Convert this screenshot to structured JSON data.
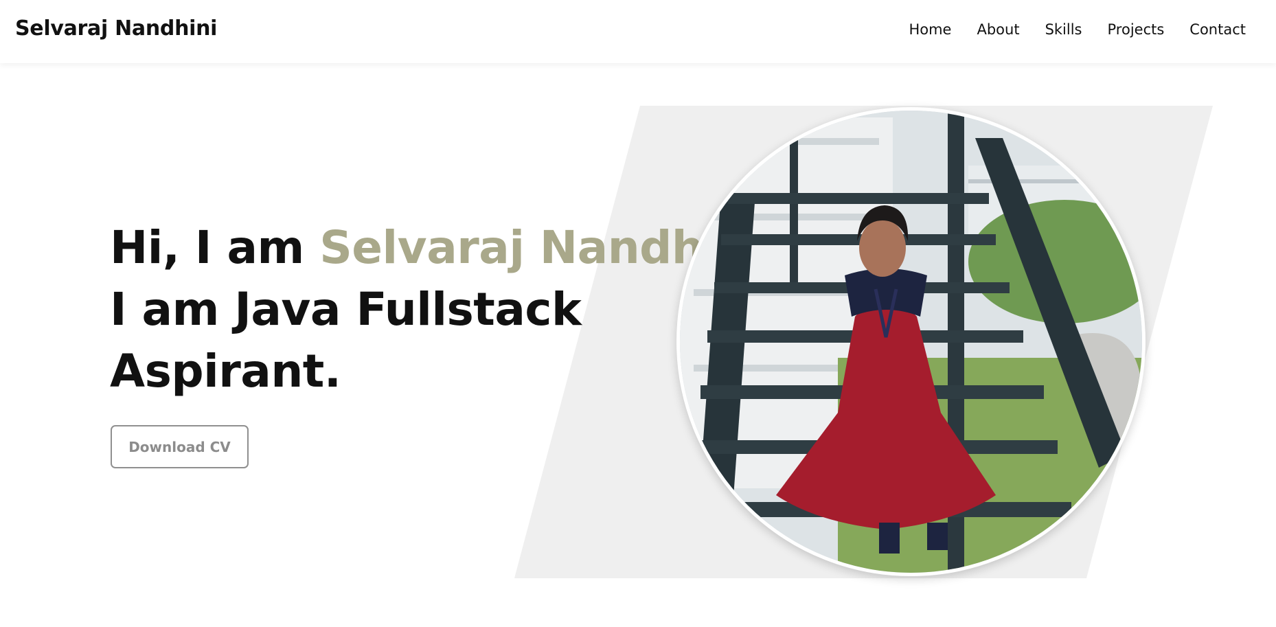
{
  "nav": {
    "brand": "Selvaraj Nandhini",
    "links": [
      {
        "label": "Home"
      },
      {
        "label": "About"
      },
      {
        "label": "Skills"
      },
      {
        "label": "Projects"
      },
      {
        "label": "Contact"
      }
    ]
  },
  "hero": {
    "greeting": "Hi, I am",
    "name": "Selvaraj Nandhini",
    "role_line_1": "I am Java Fullstack",
    "role_line_2": "Aspirant.",
    "download_cv_label": "Download CV",
    "photo_alt": "Profile photo of Selvaraj Nandhini"
  },
  "colors": {
    "accent": "#a9a88a",
    "text": "#111111",
    "panel": "#efefef",
    "button_border": "#8f8f8f"
  }
}
